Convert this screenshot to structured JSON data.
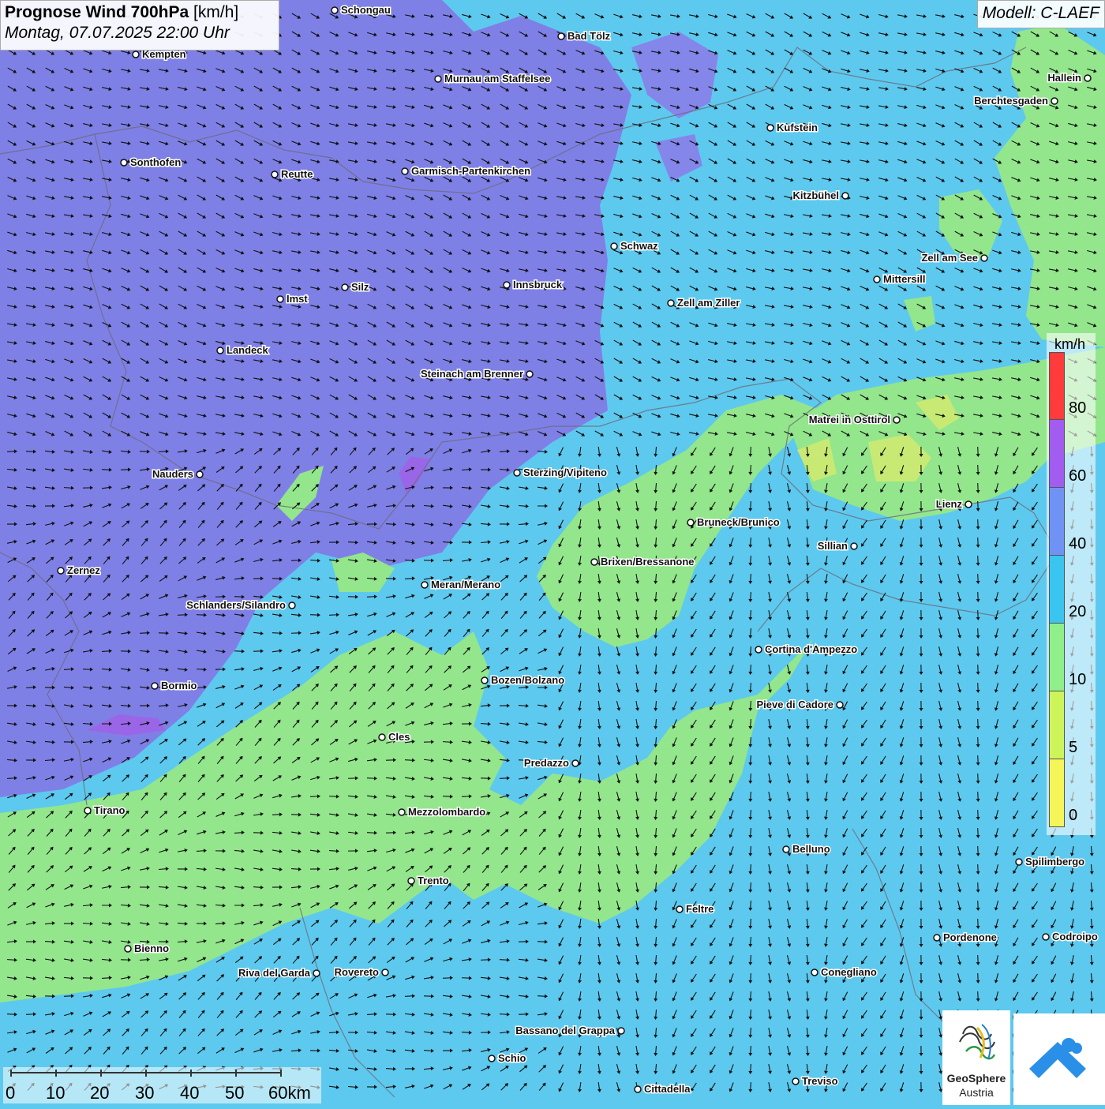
{
  "header": {
    "title_bold": "Prognose Wind 700hPa",
    "title_unit": "[km/h]",
    "datetime": "Montag, 07.07.2025 22:00 Uhr",
    "model": "Modell: C-LAEF"
  },
  "legend": {
    "unit": "km/h",
    "colors": [
      "#ff3b3b",
      "#a25cf0",
      "#6f93f5",
      "#39c5f0",
      "#8ff08a",
      "#cdf55a",
      "#f5f55a"
    ],
    "labels": [
      "80",
      "60",
      "40",
      "20",
      "10",
      "5",
      "0"
    ]
  },
  "colors": {
    "purple_zone": "#7f80e6",
    "blue_zone": "#5ec9ee",
    "green_zone": "#93e68c",
    "yellow_green_zone": "#c8ea74",
    "border": "#6a6a7a"
  },
  "cities": [
    {
      "name": "Schongau"
    },
    {
      "name": "Bad Tölz"
    },
    {
      "name": "Kempten"
    },
    {
      "name": "Murnau am Staffelsee"
    },
    {
      "name": "Hallein"
    },
    {
      "name": "Berchtesgaden"
    },
    {
      "name": "Kufstein"
    },
    {
      "name": "Sonthofen"
    },
    {
      "name": "Reutte"
    },
    {
      "name": "Garmisch-Partenkirchen"
    },
    {
      "name": "Kitzbühel"
    },
    {
      "name": "Schwaz"
    },
    {
      "name": "Zell am See"
    },
    {
      "name": "Mittersill"
    },
    {
      "name": "Innsbruck"
    },
    {
      "name": "Silz"
    },
    {
      "name": "Imst"
    },
    {
      "name": "Zell am Ziller"
    },
    {
      "name": "Landeck"
    },
    {
      "name": "Steinach am Brenner"
    },
    {
      "name": "Matrei in Osttirol"
    },
    {
      "name": "Nauders"
    },
    {
      "name": "Sterzing/Vipiteno"
    },
    {
      "name": "Lienz"
    },
    {
      "name": "Bruneck/Brunico"
    },
    {
      "name": "Sillian"
    },
    {
      "name": "Zernez"
    },
    {
      "name": "Brixen/Bressanone"
    },
    {
      "name": "Meran/Merano"
    },
    {
      "name": "Schlanders/Silandro"
    },
    {
      "name": "Cortina d'Ampezzo"
    },
    {
      "name": "Bozen/Bolzano"
    },
    {
      "name": "Bormio"
    },
    {
      "name": "Pieve di Cadore"
    },
    {
      "name": "Cles"
    },
    {
      "name": "Predazzo"
    },
    {
      "name": "Tirano"
    },
    {
      "name": "Mezzolombardo"
    },
    {
      "name": "Belluno"
    },
    {
      "name": "Spilimbergo"
    },
    {
      "name": "Trento"
    },
    {
      "name": "Feltre"
    },
    {
      "name": "Bienno"
    },
    {
      "name": "Pordenone"
    },
    {
      "name": "Codroipo"
    },
    {
      "name": "Riva del Garda"
    },
    {
      "name": "Rovereto"
    },
    {
      "name": "Conegliano"
    },
    {
      "name": "Bassano del Grappa"
    },
    {
      "name": "Schio"
    },
    {
      "name": "Treviso"
    },
    {
      "name": "Cittadella"
    }
  ],
  "scale_bar": {
    "labels": [
      "0",
      "10",
      "20",
      "30",
      "40",
      "50",
      "60km"
    ]
  },
  "logos": {
    "geosphere_line1": "GeoSphere",
    "geosphere_line2": "Austria"
  },
  "icons": {
    "city_marker": "circle-marker",
    "wind_arrow": "wind-arrow-icon"
  }
}
